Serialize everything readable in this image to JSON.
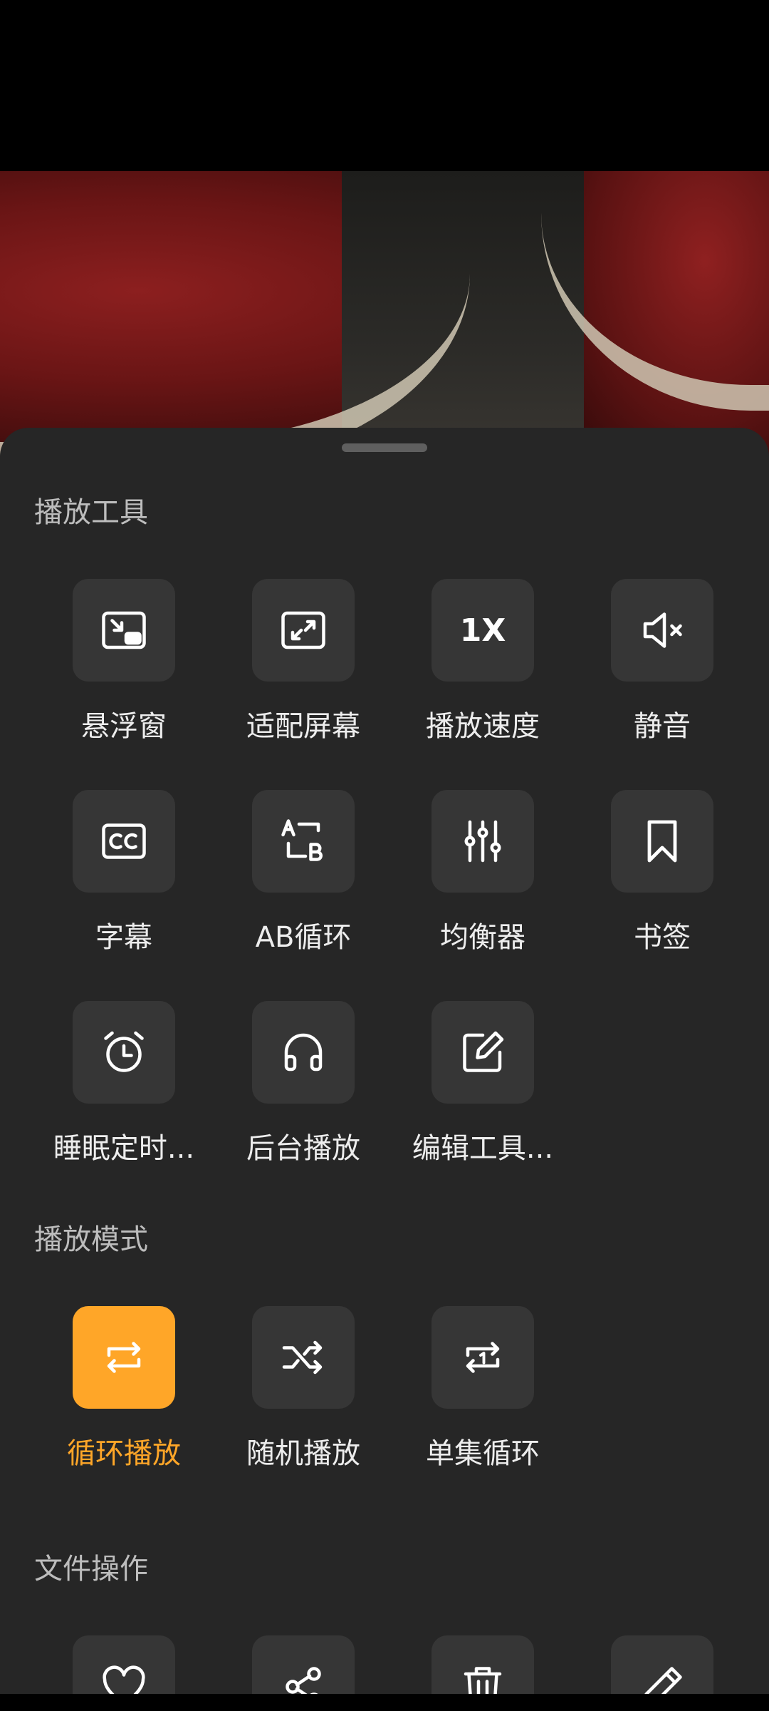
{
  "sheet": {
    "tools_title": "播放工具",
    "tools": [
      {
        "label": "悬浮窗",
        "icon": "picture-in-picture-icon"
      },
      {
        "label": "适配屏幕",
        "icon": "expand-screen-icon"
      },
      {
        "label": "播放速度",
        "icon": "speed-icon",
        "value": "1X"
      },
      {
        "label": "静音",
        "icon": "mute-icon"
      },
      {
        "label": "字幕",
        "icon": "subtitles-icon"
      },
      {
        "label": "AB循环",
        "icon": "ab-loop-icon"
      },
      {
        "label": "均衡器",
        "icon": "equalizer-icon"
      },
      {
        "label": "书签",
        "icon": "bookmark-icon"
      },
      {
        "label": "睡眠定时...",
        "icon": "alarm-clock-icon"
      },
      {
        "label": "后台播放",
        "icon": "headphones-icon"
      },
      {
        "label": "编辑工具...",
        "icon": "edit-icon"
      }
    ],
    "mode_title": "播放模式",
    "modes": [
      {
        "label": "循环播放",
        "icon": "repeat-icon",
        "active": true
      },
      {
        "label": "随机播放",
        "icon": "shuffle-icon",
        "active": false
      },
      {
        "label": "单集循环",
        "icon": "repeat-one-icon",
        "active": false
      }
    ],
    "file_title": "文件操作",
    "file_ops": [
      {
        "icon": "heart-icon"
      },
      {
        "icon": "share-icon"
      },
      {
        "icon": "trash-icon"
      },
      {
        "icon": "pencil-icon"
      }
    ]
  },
  "colors": {
    "accent": "#FFA628",
    "sheet_bg": "#262626",
    "button_bg": "#363636"
  }
}
